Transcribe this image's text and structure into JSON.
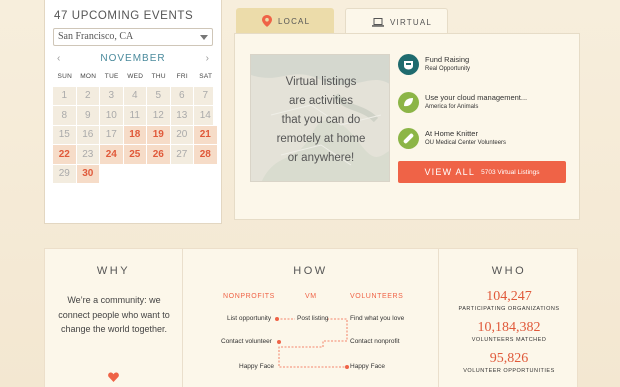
{
  "calendar": {
    "title": "47 UPCOMING EVENTS",
    "city": "San Francisco, CA",
    "prev": "‹",
    "next": "›",
    "month": "NOVEMBER",
    "weekdays": [
      "SUN",
      "MON",
      "TUE",
      "WED",
      "THU",
      "FRI",
      "SAT"
    ],
    "weeks": [
      [
        {
          "d": "1",
          "e": false
        },
        {
          "d": "2",
          "e": false
        },
        {
          "d": "3",
          "e": false
        },
        {
          "d": "4",
          "e": false
        },
        {
          "d": "5",
          "e": false
        },
        {
          "d": "6",
          "e": false
        },
        {
          "d": "7",
          "e": false
        }
      ],
      [
        {
          "d": "8",
          "e": false
        },
        {
          "d": "9",
          "e": false
        },
        {
          "d": "10",
          "e": false
        },
        {
          "d": "11",
          "e": false
        },
        {
          "d": "12",
          "e": false
        },
        {
          "d": "13",
          "e": false
        },
        {
          "d": "14",
          "e": false
        }
      ],
      [
        {
          "d": "15",
          "e": false
        },
        {
          "d": "16",
          "e": false
        },
        {
          "d": "17",
          "e": false
        },
        {
          "d": "18",
          "e": true
        },
        {
          "d": "19",
          "e": true
        },
        {
          "d": "20",
          "e": false
        },
        {
          "d": "21",
          "e": true
        }
      ],
      [
        {
          "d": "22",
          "e": true
        },
        {
          "d": "23",
          "e": false
        },
        {
          "d": "24",
          "e": true
        },
        {
          "d": "25",
          "e": true
        },
        {
          "d": "26",
          "e": true
        },
        {
          "d": "27",
          "e": false
        },
        {
          "d": "28",
          "e": true
        }
      ],
      [
        {
          "d": "29",
          "e": false
        },
        {
          "d": "30",
          "e": true
        },
        {
          "d": "",
          "e": false
        },
        {
          "d": "",
          "e": false
        },
        {
          "d": "",
          "e": false
        },
        {
          "d": "",
          "e": false
        },
        {
          "d": "",
          "e": false
        }
      ]
    ]
  },
  "tabs": {
    "local": "LOCAL",
    "virtual": "VIRTUAL",
    "active": "virtual"
  },
  "virtual": {
    "map_text": [
      "Virtual listings",
      "are activities",
      "that you can do",
      "remotely at home",
      "or anywhere!"
    ],
    "listings": [
      {
        "title": "Fund Raising",
        "org": "Real Opportunity",
        "icon": "piggy-bank-icon",
        "color": "#1f6b6e"
      },
      {
        "title": "Use your cloud management...",
        "org": "America for Animals",
        "icon": "leaf-icon",
        "color": "#8cb547"
      },
      {
        "title": "At Home Knitter",
        "org": "OU Medical Center Volunteers",
        "icon": "bandage-icon",
        "color": "#8cb547"
      }
    ],
    "view_all": "VIEW ALL",
    "view_all_count": "5703 Virtual Listings"
  },
  "why": {
    "title": "WHY",
    "text": "We’re a community: we connect people who want to change the world together."
  },
  "how": {
    "title": "HOW",
    "headers": [
      "NONPROFITS",
      "VM",
      "VOLUNTEERS"
    ],
    "left_steps": [
      "List opportunity",
      "Contact volunteer",
      "Happy Face"
    ],
    "center_steps": [
      "Post listing"
    ],
    "right_steps": [
      "Find what you love",
      "Contact nonprofit",
      "Happy Face"
    ]
  },
  "who": {
    "title": "WHO",
    "stats": [
      {
        "value": "104,247",
        "label": "PARTICIPATING ORGANIZATIONS"
      },
      {
        "value": "10,184,382",
        "label": "VOLUNTEERS MATCHED"
      },
      {
        "value": "95,826",
        "label": "VOLUNTEER OPPORTUNITIES"
      }
    ]
  },
  "colors": {
    "accent": "#ef6347",
    "teal": "#4a8a9c",
    "event_bg": "#f6dcc8",
    "tab_local": "#ecdcaa"
  }
}
